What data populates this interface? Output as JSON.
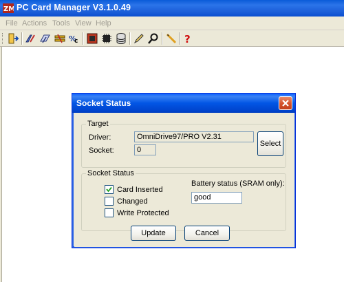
{
  "app": {
    "title": "PC Card Manager V3.1.0.49"
  },
  "menu": {
    "items": [
      "File",
      "Actions",
      "Tools",
      "View",
      "Help"
    ]
  },
  "toolbar": {
    "icons": [
      "exit-icon",
      "open-icon",
      "copy-card-icon",
      "compare-icon",
      "format-icon",
      "card-icon",
      "chip-icon",
      "database-icon",
      "edit-icon",
      "search-icon",
      "pen-icon",
      "help-icon"
    ]
  },
  "dialog": {
    "title": "Socket Status",
    "target": {
      "legend": "Target",
      "driver_label": "Driver:",
      "driver_value": "OmniDrive97/PRO  V2.31",
      "socket_label": "Socket:",
      "socket_value": "0",
      "select_label": "Select"
    },
    "socket_status": {
      "legend": "Socket Status",
      "card_inserted_label": "Card Inserted",
      "card_inserted_checked": true,
      "changed_label": "Changed",
      "changed_checked": false,
      "write_protected_label": "Write Protected",
      "write_protected_checked": false,
      "battery_label": "Battery status (SRAM only):",
      "battery_value": "good"
    },
    "update_label": "Update",
    "cancel_label": "Cancel"
  }
}
